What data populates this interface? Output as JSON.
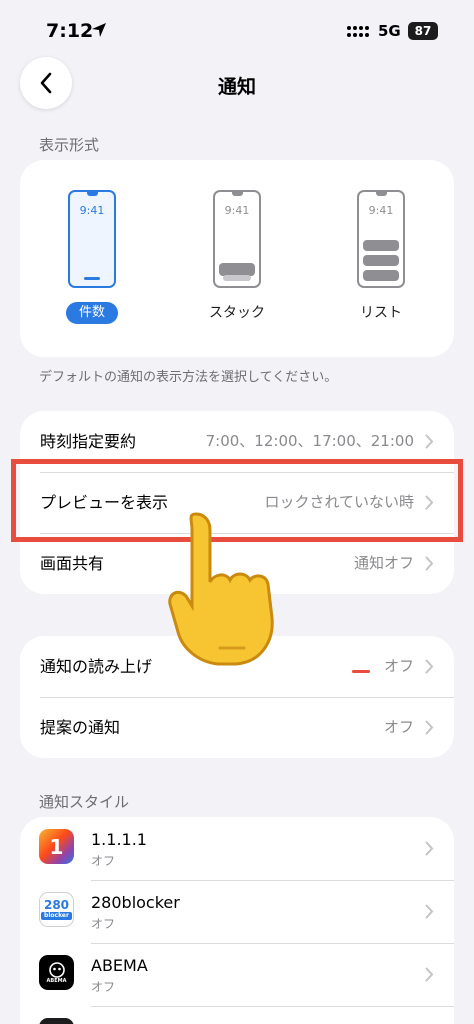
{
  "status": {
    "time": "7:12",
    "network": "5G",
    "battery": "87"
  },
  "nav": {
    "title": "通知"
  },
  "display_style": {
    "label": "表示形式",
    "clock": "9:41",
    "options": [
      {
        "label": "件数",
        "selected": true
      },
      {
        "label": "スタック",
        "selected": false
      },
      {
        "label": "リスト",
        "selected": false
      }
    ],
    "description": "デフォルトの通知の表示方法を選択してください。"
  },
  "settings": [
    {
      "label": "時刻指定要約",
      "value": "7:00、12:00、17:00、21:00"
    },
    {
      "label": "プレビューを表示",
      "value": "ロックされていない時"
    },
    {
      "label": "画面共有",
      "value": "通知オフ"
    }
  ],
  "settings2": [
    {
      "label": "通知の読み上げ",
      "value": "オフ"
    },
    {
      "label": "提案の通知",
      "value": "オフ"
    }
  ],
  "notification_style": {
    "label": "通知スタイル",
    "apps": [
      {
        "name": "1.1.1.1",
        "status": "オフ",
        "icon": "warp-1111-icon",
        "badge": "1"
      },
      {
        "name": "280blocker",
        "status": "オフ",
        "icon": "280blocker-icon",
        "badge": "280",
        "badge_sub": "blocker"
      },
      {
        "name": "ABEMA",
        "status": "オフ",
        "icon": "abema-icon",
        "badge": "ABEMA"
      }
    ]
  },
  "colors": {
    "accent": "#2a7ae2",
    "highlight": "#e74c3c",
    "background": "#f2f2f7"
  }
}
